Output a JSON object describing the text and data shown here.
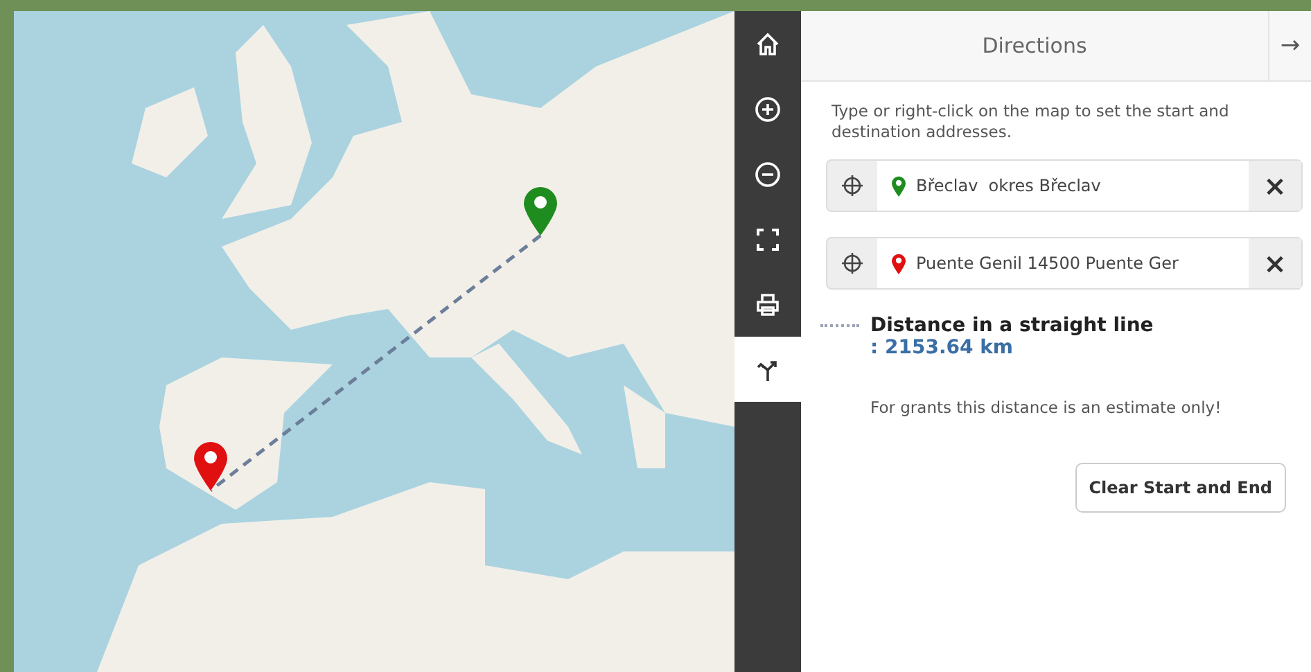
{
  "map": {
    "markers": [
      {
        "kind": "start",
        "color": "#1e8c1e"
      },
      {
        "kind": "end",
        "color": "#e01010"
      }
    ]
  },
  "toolbar": [
    {
      "kind": "home",
      "selected": false
    },
    {
      "kind": "zoom-in",
      "selected": false
    },
    {
      "kind": "zoom-out",
      "selected": false
    },
    {
      "kind": "fullscreen",
      "selected": false
    },
    {
      "kind": "print",
      "selected": false
    },
    {
      "kind": "directions",
      "selected": true
    }
  ],
  "panel": {
    "title": "Directions",
    "close": "→",
    "intro": "Type or right-click on the map to set the start and destination addresses.",
    "fields": [
      {
        "value": "Břeclav  okres Břeclav",
        "color": "#1e8c1e",
        "clear": "×"
      },
      {
        "value": "Puente Genil 14500 Puente Ger",
        "color": "#e01010",
        "clear": "×"
      }
    ],
    "distance_label": "Distance in a straight line",
    "distance_value": ": 2153.64 km",
    "note": "For grants this distance is an estimate only!",
    "button": "Clear Start and End"
  }
}
